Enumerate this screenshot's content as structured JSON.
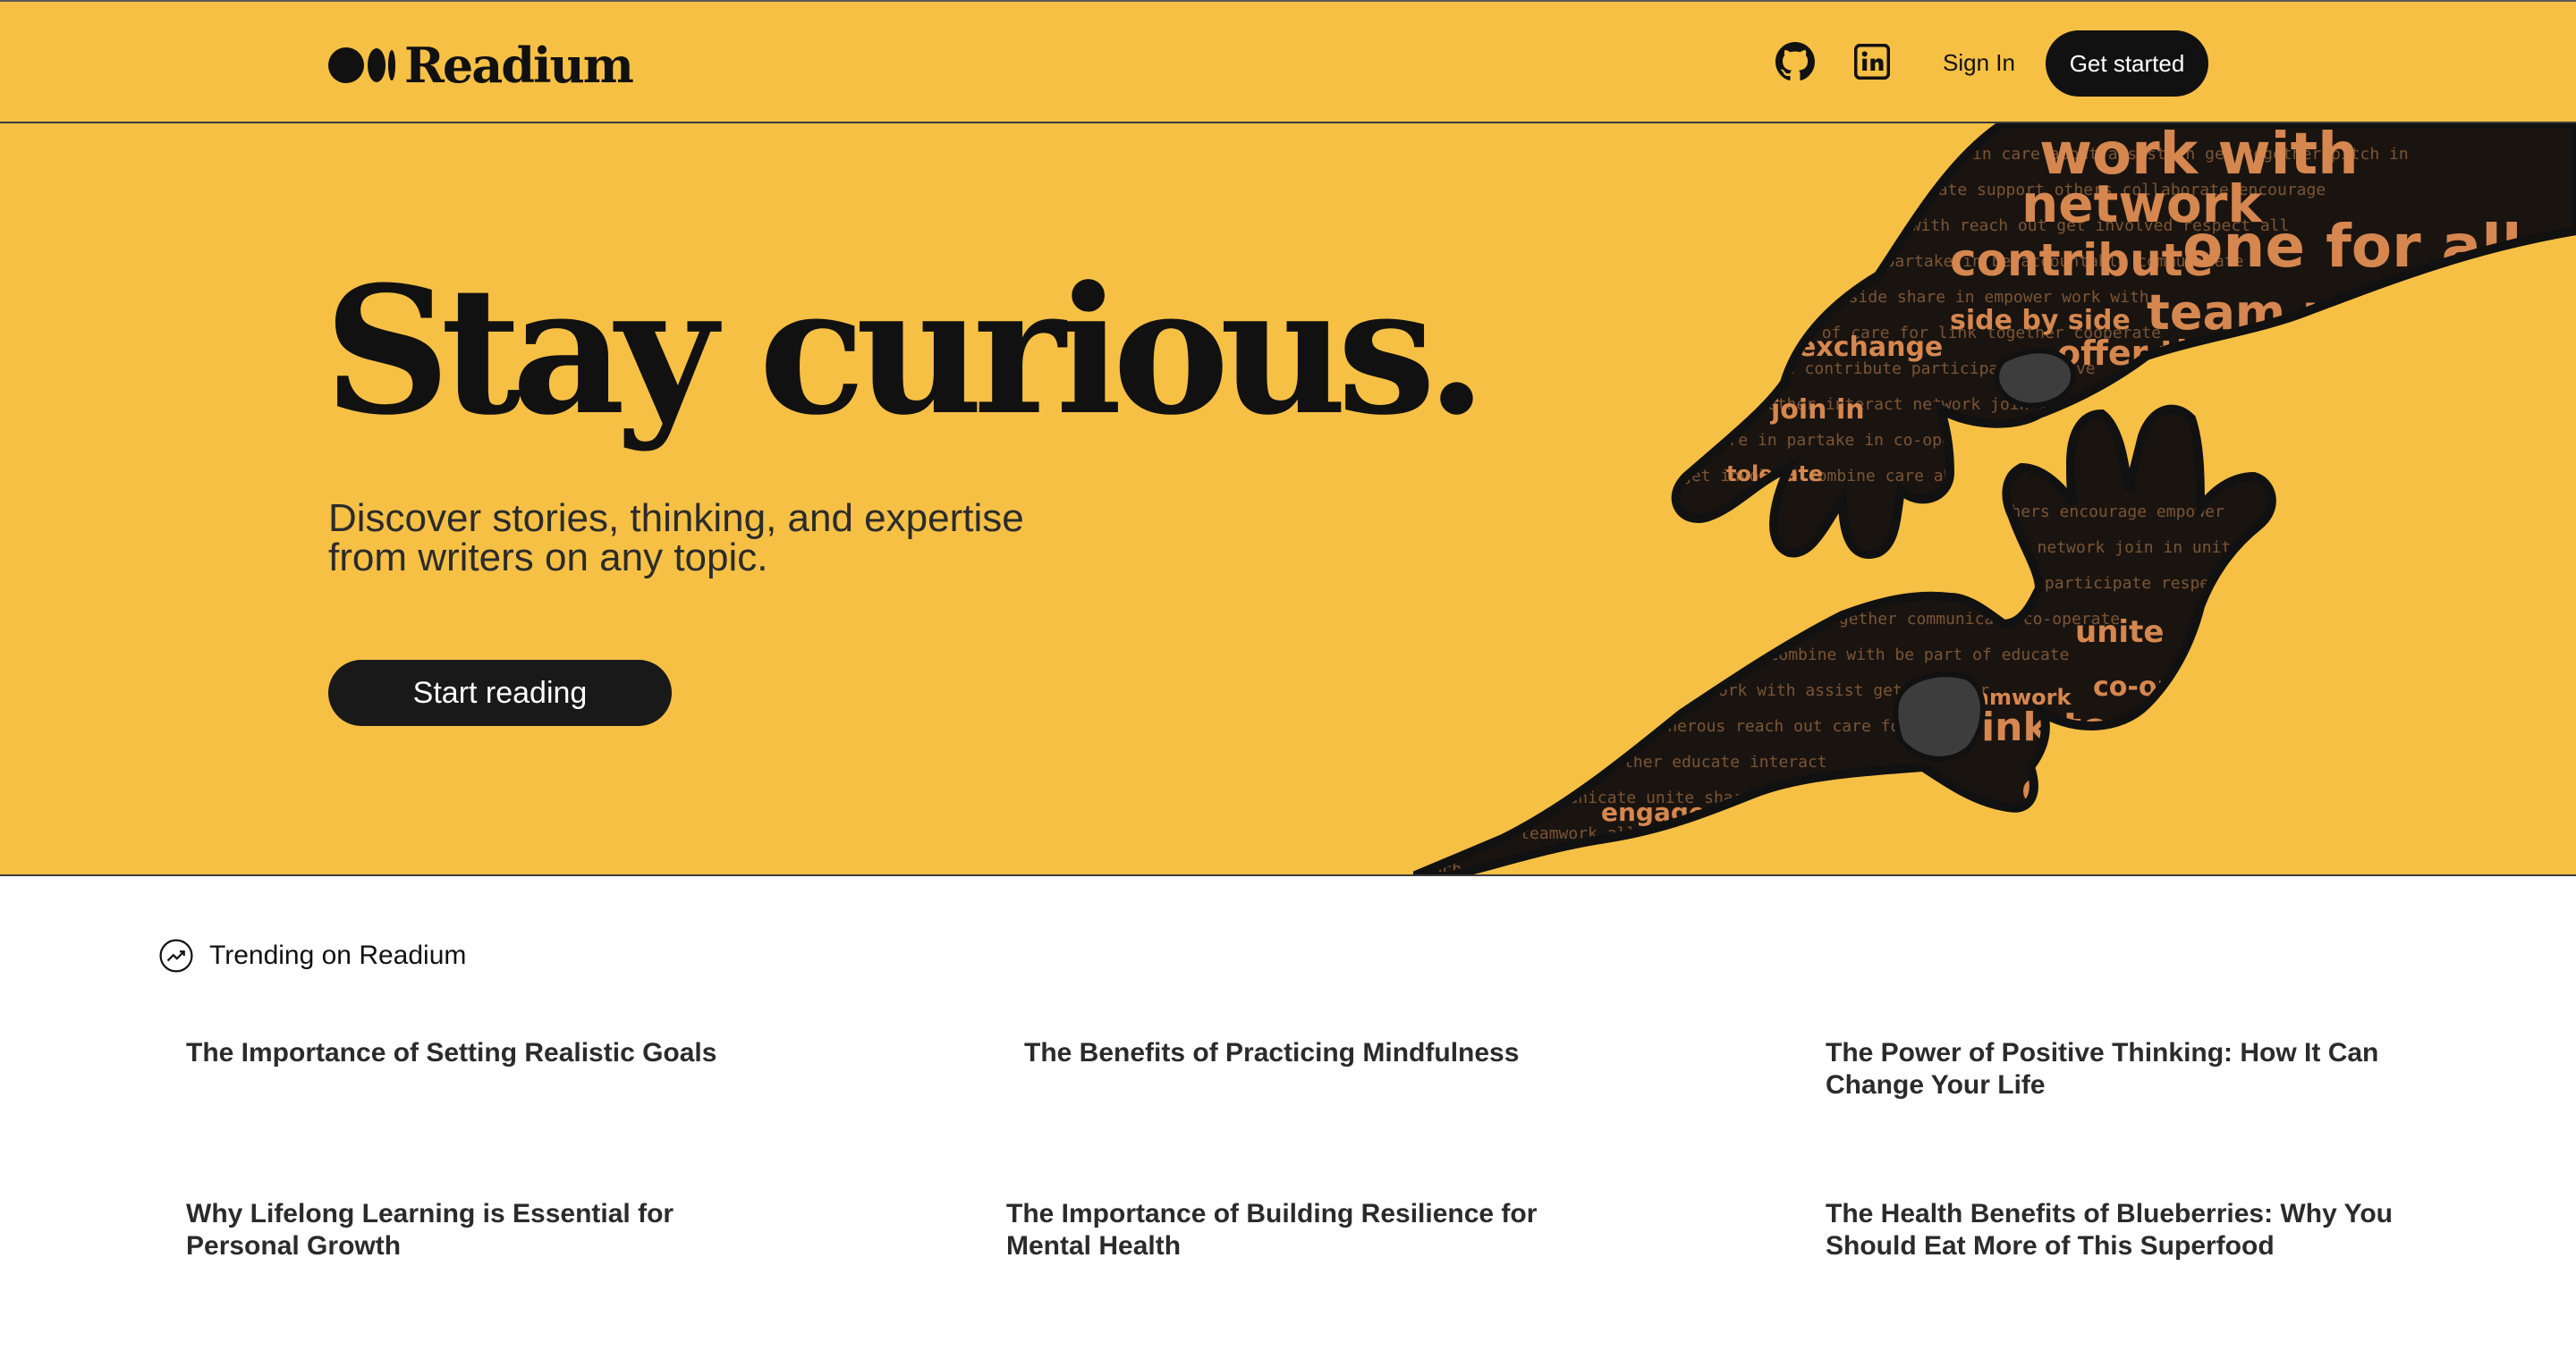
{
  "header": {
    "logo_text": "Readium",
    "sign_in": "Sign In",
    "get_started": "Get started"
  },
  "hero": {
    "headline": "Stay curious.",
    "subhead": "Discover stories, thinking, and expertise from writers on any topic.",
    "cta": "Start reading",
    "art_words": [
      "work with",
      "network",
      "one for all",
      "contribute",
      "team up",
      "side by side",
      "offer thanks",
      "exchange",
      "join in",
      "tolerate",
      "link together",
      "educate",
      "unite",
      "co-operate",
      "teamwork",
      "engage with"
    ]
  },
  "trending": {
    "title": "Trending on Readium",
    "articles": [
      "The Importance of Setting Realistic Goals",
      "The Benefits of Practicing Mindfulness",
      "The Power of Positive Thinking: How It Can Change Your Life",
      "Why Lifelong Learning is Essential for Personal Growth",
      "The Importance of Building Resilience for Mental Health",
      "The Health Benefits of Blueberries: Why You Should Eat More of This Superfood"
    ]
  },
  "colors": {
    "brand_yellow": "#f6c045",
    "dark": "#111111"
  },
  "icons": [
    "github-icon",
    "linkedin-icon",
    "trending-icon"
  ]
}
